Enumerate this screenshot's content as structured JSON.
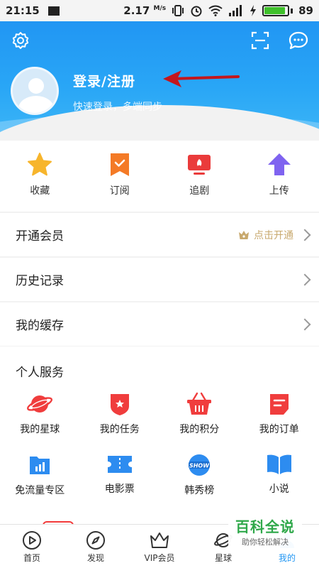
{
  "status_bar": {
    "time": "21:15",
    "speed": "2.17",
    "speed_unit": "M/s",
    "battery": "89",
    "battery_level": 0.89
  },
  "header": {
    "login_title": "登录/注册",
    "login_subtitle": "快速登录，多端同步",
    "colors": {
      "gradient_top": "#2196f3",
      "gradient_bottom": "#3db6f7"
    }
  },
  "quick_actions": [
    {
      "label": "收藏",
      "icon": "star-icon",
      "color": "#f7b52c"
    },
    {
      "label": "订阅",
      "icon": "bookmark-icon",
      "color": "#f47a26"
    },
    {
      "label": "追剧",
      "icon": "tv-icon",
      "color": "#ea3b3b"
    },
    {
      "label": "上传",
      "icon": "upload-arrow-icon",
      "color": "#7f63f0"
    }
  ],
  "rows": {
    "vip": {
      "title": "开通会员",
      "hint": "点击开通"
    },
    "history": {
      "title": "历史记录"
    },
    "cache": {
      "title": "我的缓存"
    }
  },
  "services": {
    "title": "个人服务",
    "items": [
      {
        "label": "我的星球",
        "icon": "planet-icon"
      },
      {
        "label": "我的任务",
        "icon": "task-badge-icon"
      },
      {
        "label": "我的积分",
        "icon": "basket-icon"
      },
      {
        "label": "我的订单",
        "icon": "order-icon"
      },
      {
        "label": "免流量专区",
        "icon": "data-chart-icon"
      },
      {
        "label": "电影票",
        "icon": "ticket-icon"
      },
      {
        "label": "韩秀榜",
        "icon": "show-icon"
      },
      {
        "label": "小说",
        "icon": "book-icon"
      }
    ]
  },
  "bottom_nav": [
    {
      "label": "首页",
      "icon": "play-circle-icon",
      "active": false
    },
    {
      "label": "发现",
      "icon": "compass-icon",
      "active": false
    },
    {
      "label": "VIP会员",
      "icon": "crown-icon",
      "active": false
    },
    {
      "label": "星球",
      "icon": "planet-outline-icon",
      "active": false
    },
    {
      "label": "我的",
      "icon": "profile-icon",
      "active": true
    }
  ],
  "watermark": {
    "main": "百科全说",
    "sub": "助你轻松解决"
  }
}
